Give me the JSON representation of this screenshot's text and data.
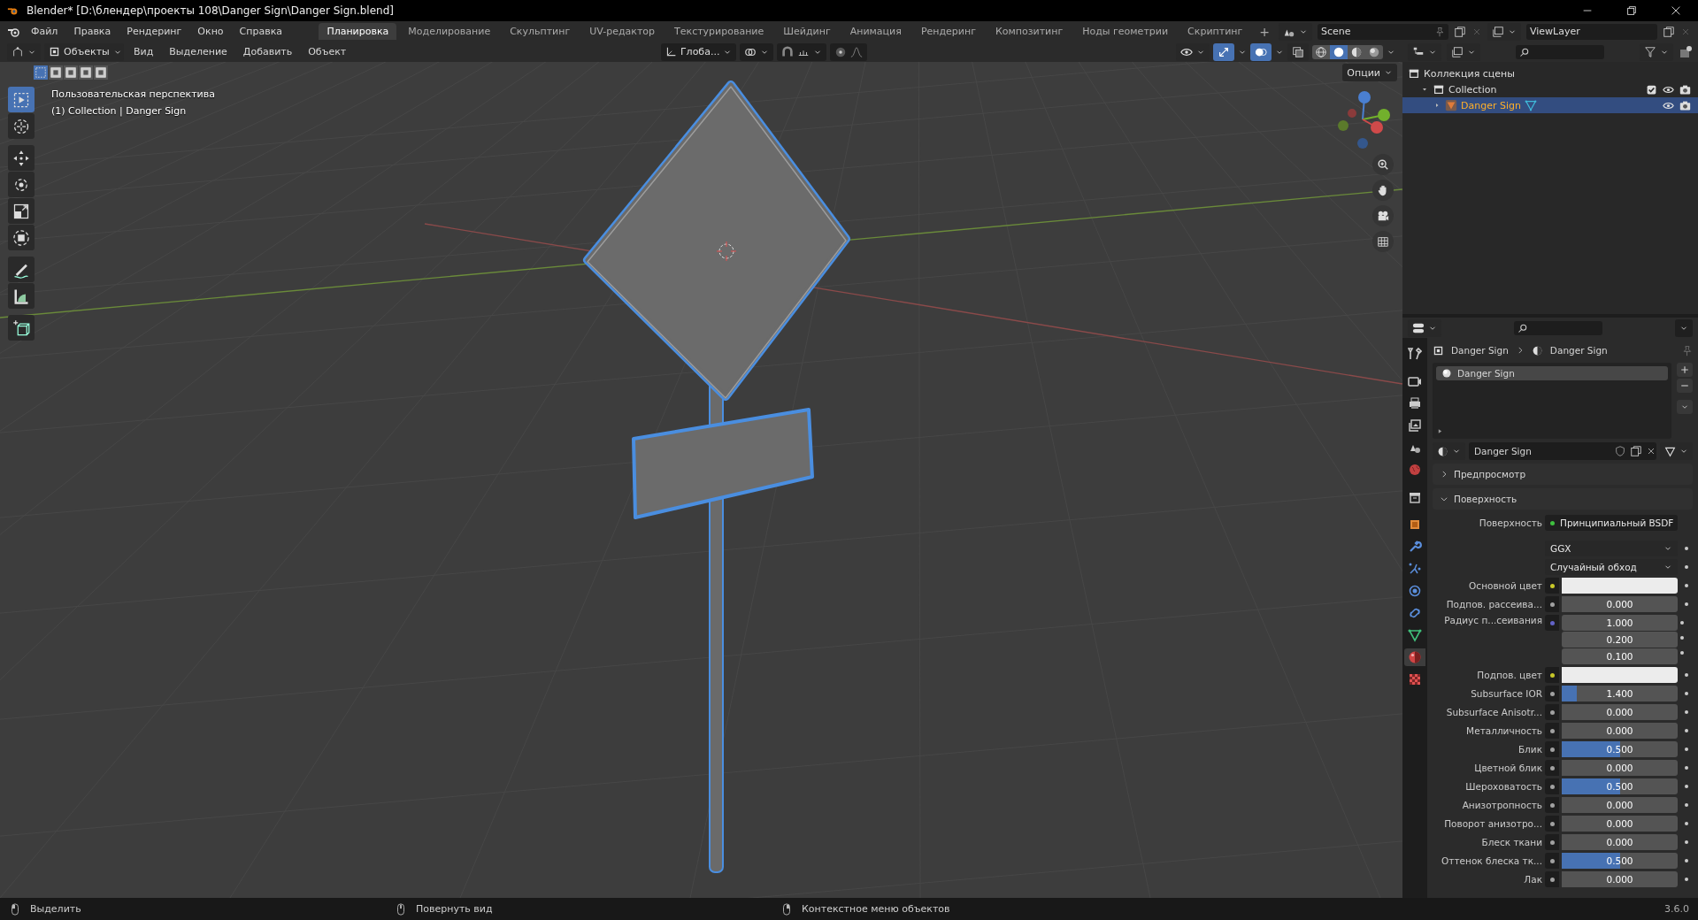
{
  "window": {
    "title": "Blender* [D:\\блендер\\проекты 108\\Danger Sign\\Danger Sign.blend]"
  },
  "menu": [
    "Файл",
    "Правка",
    "Рендеринг",
    "Окно",
    "Справка"
  ],
  "workspaces": [
    {
      "label": "Планировка",
      "selected": true
    },
    {
      "label": "Моделирование",
      "selected": false
    },
    {
      "label": "Скульптинг",
      "selected": false
    },
    {
      "label": "UV-редактор",
      "selected": false
    },
    {
      "label": "Текстурирование",
      "selected": false
    },
    {
      "label": "Шейдинг",
      "selected": false
    },
    {
      "label": "Анимация",
      "selected": false
    },
    {
      "label": "Рендеринг",
      "selected": false
    },
    {
      "label": "Композитинг",
      "selected": false
    },
    {
      "label": "Ноды геометрии",
      "selected": false
    },
    {
      "label": "Скриптинг",
      "selected": false
    }
  ],
  "add_workspace": "+",
  "scene": "Scene",
  "view_layer": "ViewLayer",
  "viewport": {
    "mode": "Объекты",
    "menus": [
      "Вид",
      "Выделение",
      "Добавить",
      "Объект"
    ],
    "orientation": "Глоба...",
    "options": "Опции",
    "view_name": "Пользовательская перспектива",
    "object_info": "(1) Collection | Danger Sign",
    "gizmos_on": true,
    "overlays_on": true,
    "select_modes": [
      {
        "selected": true
      },
      {
        "selected": false
      },
      {
        "selected": false
      },
      {
        "selected": false
      },
      {
        "selected": false
      }
    ],
    "shading": [
      {
        "selected": false
      },
      {
        "selected": true
      },
      {
        "selected": false
      },
      {
        "selected": false
      }
    ],
    "tools": [
      {
        "kind": "select",
        "selected": true
      },
      {
        "kind": "cursor",
        "selected": false
      },
      {
        "kind": "move",
        "selected": false
      },
      {
        "kind": "rotate",
        "selected": false
      },
      {
        "kind": "scale",
        "selected": false
      },
      {
        "kind": "transform",
        "selected": false
      },
      {
        "kind": "annotate",
        "selected": false
      },
      {
        "kind": "measure",
        "selected": false
      },
      {
        "kind": "add-cube",
        "selected": false
      }
    ]
  },
  "outliner": {
    "items": [
      {
        "label": "Коллекция сцены",
        "children": [
          {
            "label": "Collection",
            "expanded": true,
            "checked": true,
            "children": [
              {
                "label": "Danger Sign",
                "selected": true,
                "expanded": false
              }
            ]
          }
        ]
      }
    ]
  },
  "properties": {
    "tabs": [
      {
        "kind": "tool",
        "selected": false
      },
      {
        "kind": "render",
        "selected": false
      },
      {
        "kind": "output",
        "selected": false
      },
      {
        "kind": "view-layer",
        "selected": false
      },
      {
        "kind": "scene",
        "selected": false
      },
      {
        "kind": "world",
        "selected": false
      },
      {
        "kind": "collection",
        "selected": false
      },
      {
        "kind": "object",
        "selected": false
      },
      {
        "kind": "modifiers",
        "selected": false
      },
      {
        "kind": "particles",
        "selected": false
      },
      {
        "kind": "physics",
        "selected": false
      },
      {
        "kind": "constraints",
        "selected": false
      },
      {
        "kind": "data",
        "selected": false
      },
      {
        "kind": "material",
        "selected": true
      },
      {
        "kind": "texture",
        "selected": false
      }
    ],
    "breadcrumb": [
      "Danger Sign",
      "Danger Sign"
    ],
    "slots": [
      {
        "label": "Danger Sign",
        "selected": true
      }
    ],
    "material": "Danger Sign",
    "panels": [
      {
        "label": "Предпросмотр",
        "expanded": false
      },
      {
        "label": "Поверхность",
        "expanded": true
      }
    ],
    "surface_label": "Поверхность",
    "surface_shader": "Принципиальный BSDF",
    "rows": [
      {
        "kind": "dropdown",
        "value": "GGX"
      },
      {
        "kind": "dropdown",
        "value": "Случайный обход"
      },
      {
        "kind": "color",
        "label": "Основной цвет",
        "color": "#ececec"
      },
      {
        "kind": "number",
        "label": "Подпов. рассеива...",
        "value": "0.000",
        "level": 0
      },
      {
        "kind": "vector",
        "label": "Радиус п...сеивания",
        "values": [
          "1.000",
          "0.200",
          "0.100"
        ]
      },
      {
        "kind": "color",
        "label": "Подпов. цвет",
        "color": "#ececec"
      },
      {
        "kind": "number",
        "label": "Subsurface IOR",
        "value": "1.400",
        "level": 0.13
      },
      {
        "kind": "number",
        "label": "Subsurface Anisotr...",
        "value": "0.000",
        "level": 0
      },
      {
        "kind": "number",
        "label": "Металличность",
        "value": "0.000",
        "level": 0
      },
      {
        "kind": "number",
        "label": "Блик",
        "value": "0.500",
        "level": 0.5
      },
      {
        "kind": "number",
        "label": "Цветной блик",
        "value": "0.000",
        "level": 0
      },
      {
        "kind": "number",
        "label": "Шероховатость",
        "value": "0.500",
        "level": 0.5
      },
      {
        "kind": "number",
        "label": "Анизотропность",
        "value": "0.000",
        "level": 0
      },
      {
        "kind": "number",
        "label": "Поворот анизотро...",
        "value": "0.000",
        "level": 0
      },
      {
        "kind": "number",
        "label": "Блеск ткани",
        "value": "0.000",
        "level": 0
      },
      {
        "kind": "number",
        "label": "Оттенок блеска тк...",
        "value": "0.500",
        "level": 0.5
      },
      {
        "kind": "number",
        "label": "Лак",
        "value": "0.000",
        "level": 0
      }
    ]
  },
  "status_bar": {
    "hints": [
      "Выделить",
      "Повернуть вид",
      "Контекстное меню объектов"
    ],
    "version": "3.6.0"
  }
}
